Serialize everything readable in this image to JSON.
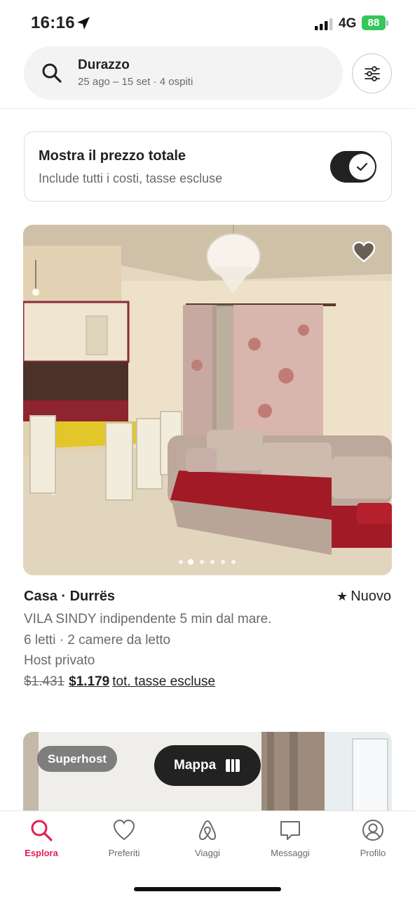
{
  "status_bar": {
    "time": "16:16",
    "network": "4G",
    "battery": "88"
  },
  "search": {
    "destination": "Durazzo",
    "details": "25 ago – 15 set · 4 ospiti",
    "icon": "search-icon"
  },
  "filters": {
    "icon": "sliders-icon"
  },
  "total_price": {
    "title": "Mostra il prezzo totale",
    "subtitle": "Include tutti i costi, tasse escluse",
    "enabled": true
  },
  "listing": {
    "title": "Casa · Durrës",
    "rating_label": "Nuovo",
    "description": "VILA SINDY indipendente 5 min dal mare.",
    "beds": "6 letti · 2 camere da letto",
    "host": "Host privato",
    "price_old": "$1.431",
    "price_new": "$1.179",
    "price_note": "tot. tasse escluse",
    "photo_count": 6,
    "photo_index": 1,
    "favorite": false
  },
  "listing2": {
    "badge": "Superhost",
    "favorite": false
  },
  "map_button": {
    "label": "Mappa"
  },
  "tabs": [
    {
      "label": "Esplora",
      "icon": "search-icon",
      "active": true
    },
    {
      "label": "Preferiti",
      "icon": "heart-icon",
      "active": false
    },
    {
      "label": "Viaggi",
      "icon": "airbnb-logo-icon",
      "active": false
    },
    {
      "label": "Messaggi",
      "icon": "message-icon",
      "active": false
    },
    {
      "label": "Profilo",
      "icon": "profile-icon",
      "active": false
    }
  ],
  "colors": {
    "accent": "#e51d53",
    "text": "#222222",
    "muted": "#6a6a6a",
    "battery": "#34c759"
  }
}
